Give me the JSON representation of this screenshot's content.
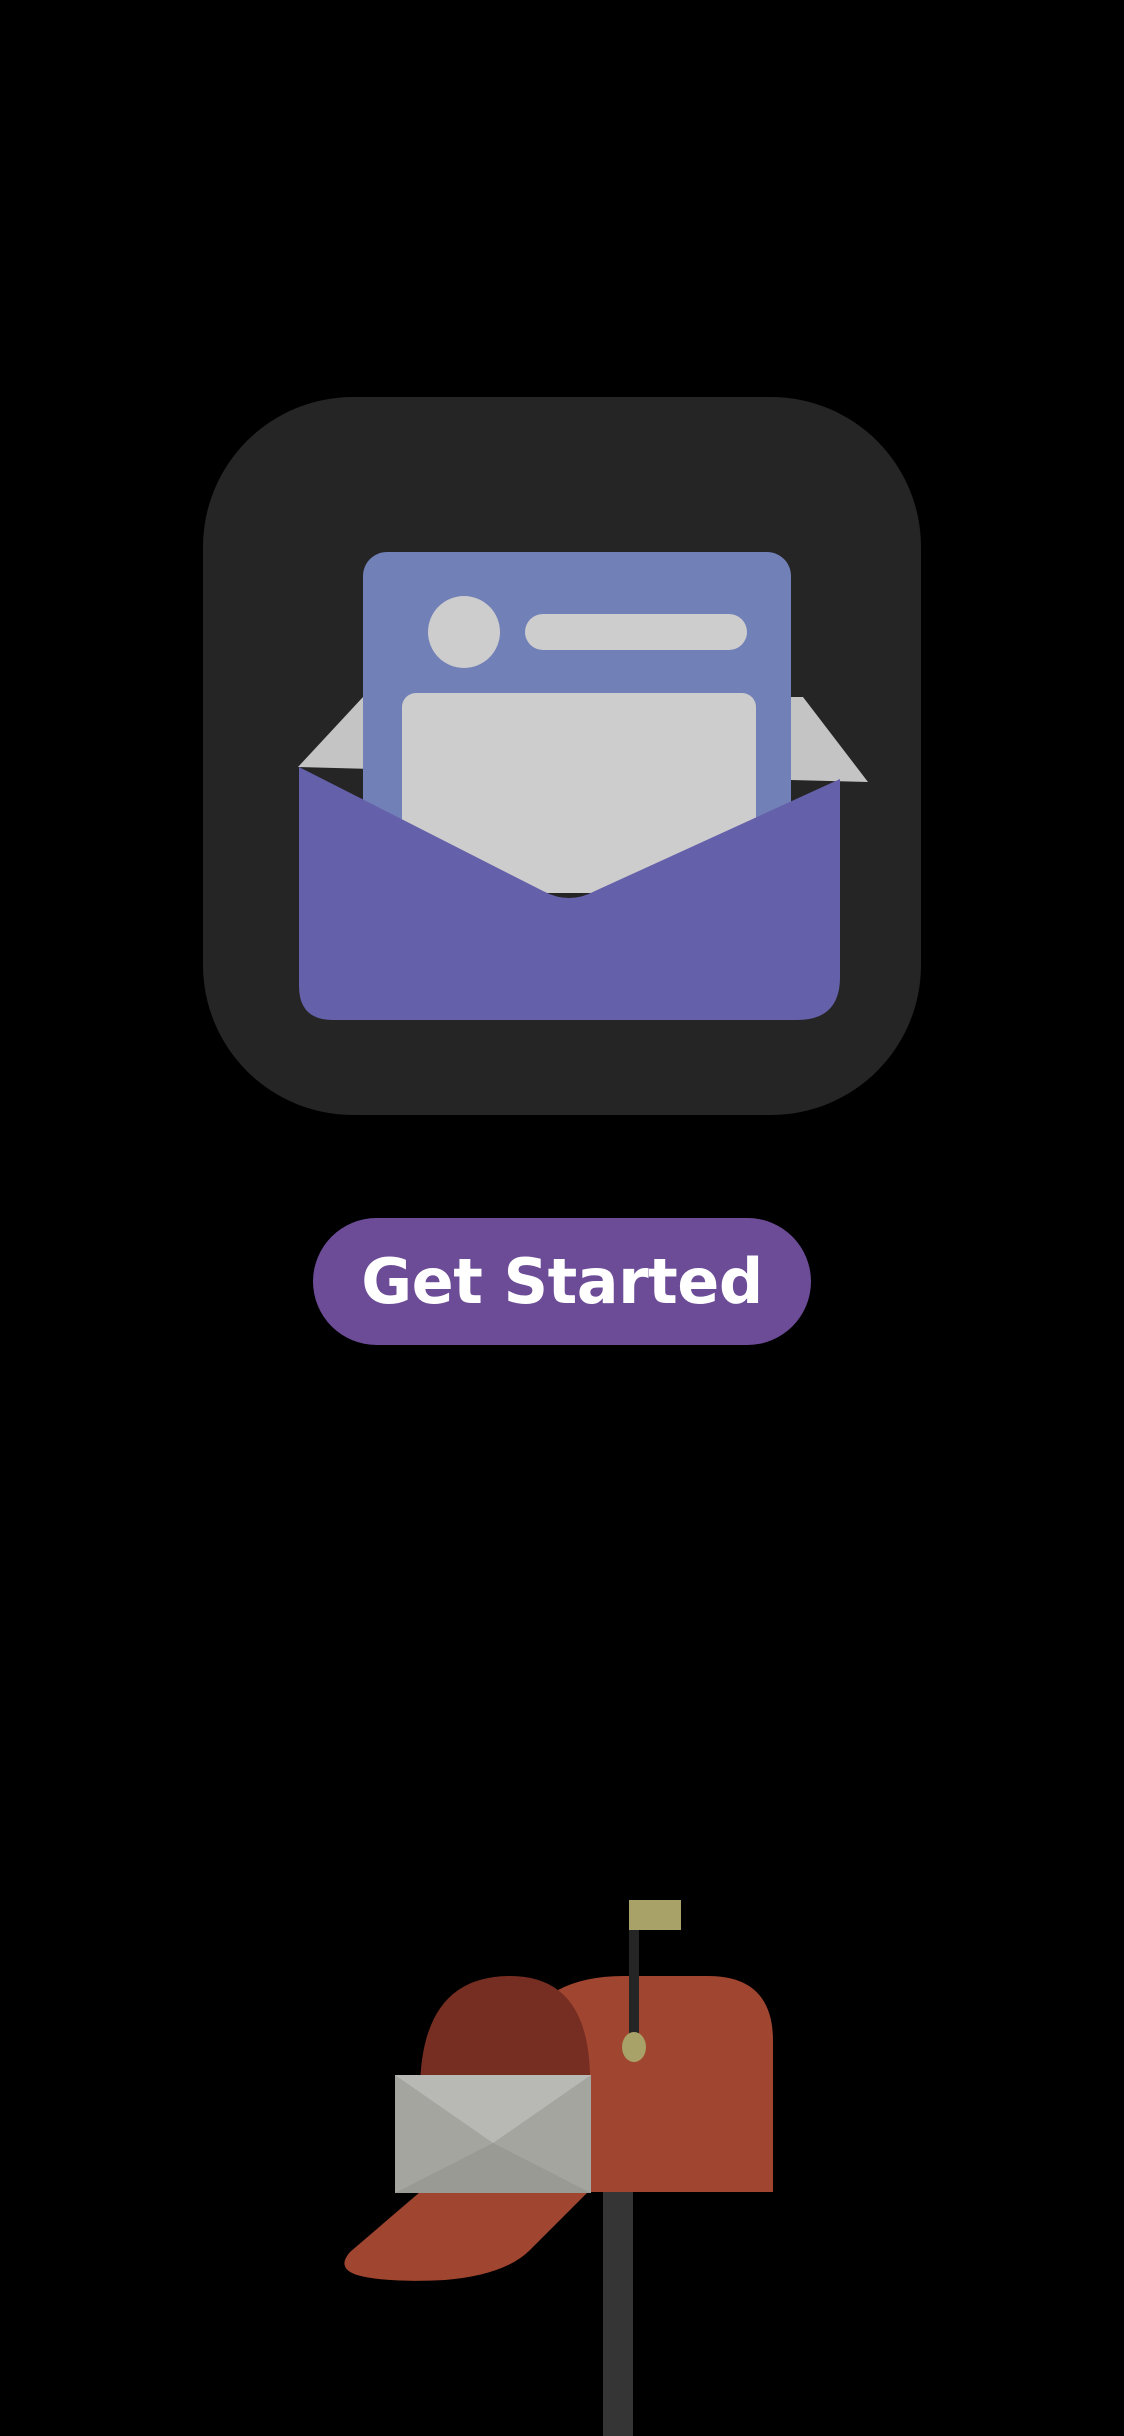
{
  "app_icon": {
    "icon": "open-envelope-icon",
    "background_color": "#252525",
    "envelope_color": "#6560aa",
    "letter_color": "#7280b8",
    "paper_color": "#cdcdcd"
  },
  "cta": {
    "label": "Get Started",
    "background_color": "#6c4c97",
    "text_color": "#ffffff"
  },
  "illustration": {
    "icon": "mailbox-icon",
    "mailbox_color": "#a04530",
    "flag_color": "#a8a268"
  }
}
